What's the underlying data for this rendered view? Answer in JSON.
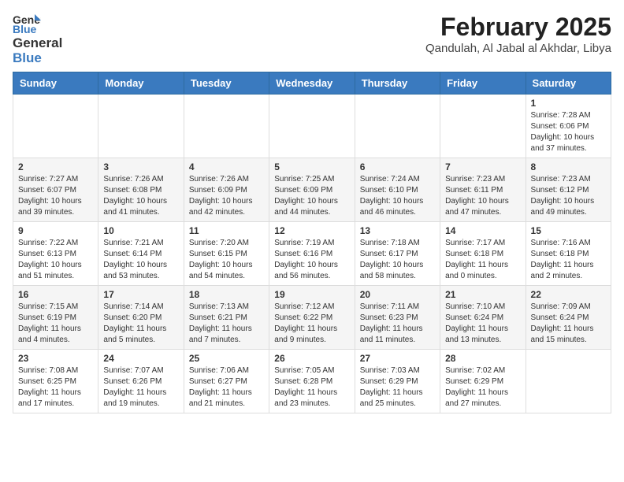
{
  "logo": {
    "general": "General",
    "blue": "Blue"
  },
  "title": "February 2025",
  "subtitle": "Qandulah, Al Jabal al Akhdar, Libya",
  "days_of_week": [
    "Sunday",
    "Monday",
    "Tuesday",
    "Wednesday",
    "Thursday",
    "Friday",
    "Saturday"
  ],
  "weeks": [
    [
      {
        "day": "",
        "info": ""
      },
      {
        "day": "",
        "info": ""
      },
      {
        "day": "",
        "info": ""
      },
      {
        "day": "",
        "info": ""
      },
      {
        "day": "",
        "info": ""
      },
      {
        "day": "",
        "info": ""
      },
      {
        "day": "1",
        "info": "Sunrise: 7:28 AM\nSunset: 6:06 PM\nDaylight: 10 hours and 37 minutes."
      }
    ],
    [
      {
        "day": "2",
        "info": "Sunrise: 7:27 AM\nSunset: 6:07 PM\nDaylight: 10 hours and 39 minutes."
      },
      {
        "day": "3",
        "info": "Sunrise: 7:26 AM\nSunset: 6:08 PM\nDaylight: 10 hours and 41 minutes."
      },
      {
        "day": "4",
        "info": "Sunrise: 7:26 AM\nSunset: 6:09 PM\nDaylight: 10 hours and 42 minutes."
      },
      {
        "day": "5",
        "info": "Sunrise: 7:25 AM\nSunset: 6:09 PM\nDaylight: 10 hours and 44 minutes."
      },
      {
        "day": "6",
        "info": "Sunrise: 7:24 AM\nSunset: 6:10 PM\nDaylight: 10 hours and 46 minutes."
      },
      {
        "day": "7",
        "info": "Sunrise: 7:23 AM\nSunset: 6:11 PM\nDaylight: 10 hours and 47 minutes."
      },
      {
        "day": "8",
        "info": "Sunrise: 7:23 AM\nSunset: 6:12 PM\nDaylight: 10 hours and 49 minutes."
      }
    ],
    [
      {
        "day": "9",
        "info": "Sunrise: 7:22 AM\nSunset: 6:13 PM\nDaylight: 10 hours and 51 minutes."
      },
      {
        "day": "10",
        "info": "Sunrise: 7:21 AM\nSunset: 6:14 PM\nDaylight: 10 hours and 53 minutes."
      },
      {
        "day": "11",
        "info": "Sunrise: 7:20 AM\nSunset: 6:15 PM\nDaylight: 10 hours and 54 minutes."
      },
      {
        "day": "12",
        "info": "Sunrise: 7:19 AM\nSunset: 6:16 PM\nDaylight: 10 hours and 56 minutes."
      },
      {
        "day": "13",
        "info": "Sunrise: 7:18 AM\nSunset: 6:17 PM\nDaylight: 10 hours and 58 minutes."
      },
      {
        "day": "14",
        "info": "Sunrise: 7:17 AM\nSunset: 6:18 PM\nDaylight: 11 hours and 0 minutes."
      },
      {
        "day": "15",
        "info": "Sunrise: 7:16 AM\nSunset: 6:18 PM\nDaylight: 11 hours and 2 minutes."
      }
    ],
    [
      {
        "day": "16",
        "info": "Sunrise: 7:15 AM\nSunset: 6:19 PM\nDaylight: 11 hours and 4 minutes."
      },
      {
        "day": "17",
        "info": "Sunrise: 7:14 AM\nSunset: 6:20 PM\nDaylight: 11 hours and 5 minutes."
      },
      {
        "day": "18",
        "info": "Sunrise: 7:13 AM\nSunset: 6:21 PM\nDaylight: 11 hours and 7 minutes."
      },
      {
        "day": "19",
        "info": "Sunrise: 7:12 AM\nSunset: 6:22 PM\nDaylight: 11 hours and 9 minutes."
      },
      {
        "day": "20",
        "info": "Sunrise: 7:11 AM\nSunset: 6:23 PM\nDaylight: 11 hours and 11 minutes."
      },
      {
        "day": "21",
        "info": "Sunrise: 7:10 AM\nSunset: 6:24 PM\nDaylight: 11 hours and 13 minutes."
      },
      {
        "day": "22",
        "info": "Sunrise: 7:09 AM\nSunset: 6:24 PM\nDaylight: 11 hours and 15 minutes."
      }
    ],
    [
      {
        "day": "23",
        "info": "Sunrise: 7:08 AM\nSunset: 6:25 PM\nDaylight: 11 hours and 17 minutes."
      },
      {
        "day": "24",
        "info": "Sunrise: 7:07 AM\nSunset: 6:26 PM\nDaylight: 11 hours and 19 minutes."
      },
      {
        "day": "25",
        "info": "Sunrise: 7:06 AM\nSunset: 6:27 PM\nDaylight: 11 hours and 21 minutes."
      },
      {
        "day": "26",
        "info": "Sunrise: 7:05 AM\nSunset: 6:28 PM\nDaylight: 11 hours and 23 minutes."
      },
      {
        "day": "27",
        "info": "Sunrise: 7:03 AM\nSunset: 6:29 PM\nDaylight: 11 hours and 25 minutes."
      },
      {
        "day": "28",
        "info": "Sunrise: 7:02 AM\nSunset: 6:29 PM\nDaylight: 11 hours and 27 minutes."
      },
      {
        "day": "",
        "info": ""
      }
    ]
  ]
}
